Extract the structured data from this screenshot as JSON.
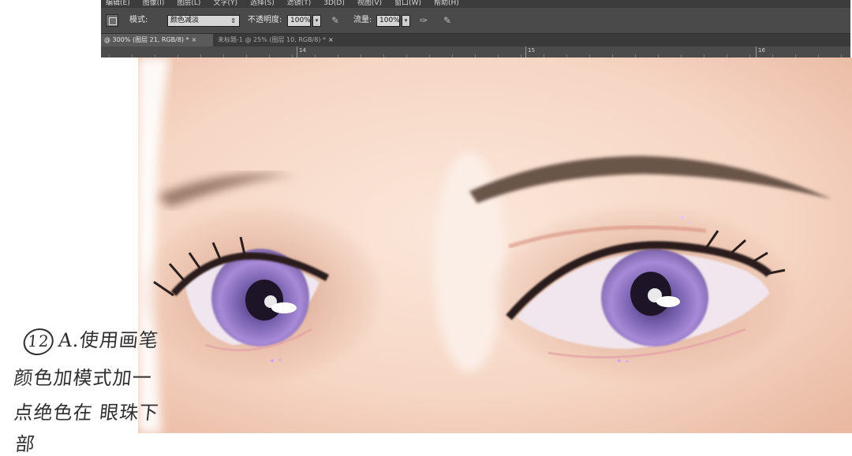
{
  "menubar": {
    "items": [
      "编辑(E)",
      "图像(I)",
      "图层(L)",
      "文字(Y)",
      "选择(S)",
      "滤镜(T)",
      "3D(D)",
      "视图(V)",
      "窗口(W)",
      "帮助(H)"
    ]
  },
  "options_bar": {
    "mode_label": "模式:",
    "mode_value": "颜色减淡",
    "opacity_label": "不透明度:",
    "opacity_value": "100%",
    "flow_label": "流量:",
    "flow_value": "100%"
  },
  "tabs": [
    {
      "label": "@ 300% (图层 21, RGB/8) *",
      "close": "×"
    },
    {
      "label": "未标题-1 @ 25% (图层 10, RGB/8) *",
      "close": "×"
    }
  ],
  "ruler": {
    "labels": [
      "14",
      "15",
      "16"
    ]
  },
  "note": {
    "step": "12",
    "line1": "A.使用画笔",
    "line2": "颜色加模式加一",
    "line3": "点绝色在  眼珠下",
    "line4": "部"
  },
  "colors": {
    "iris": "#9b7fd6",
    "skin": "#f6d9c8",
    "brow": "#6b5448"
  },
  "icons": {
    "tool_preset": "brush-preset-icon",
    "pressure_opacity": "pressure-opacity-icon",
    "airbrush": "airbrush-icon",
    "pressure_size": "pressure-size-icon"
  }
}
